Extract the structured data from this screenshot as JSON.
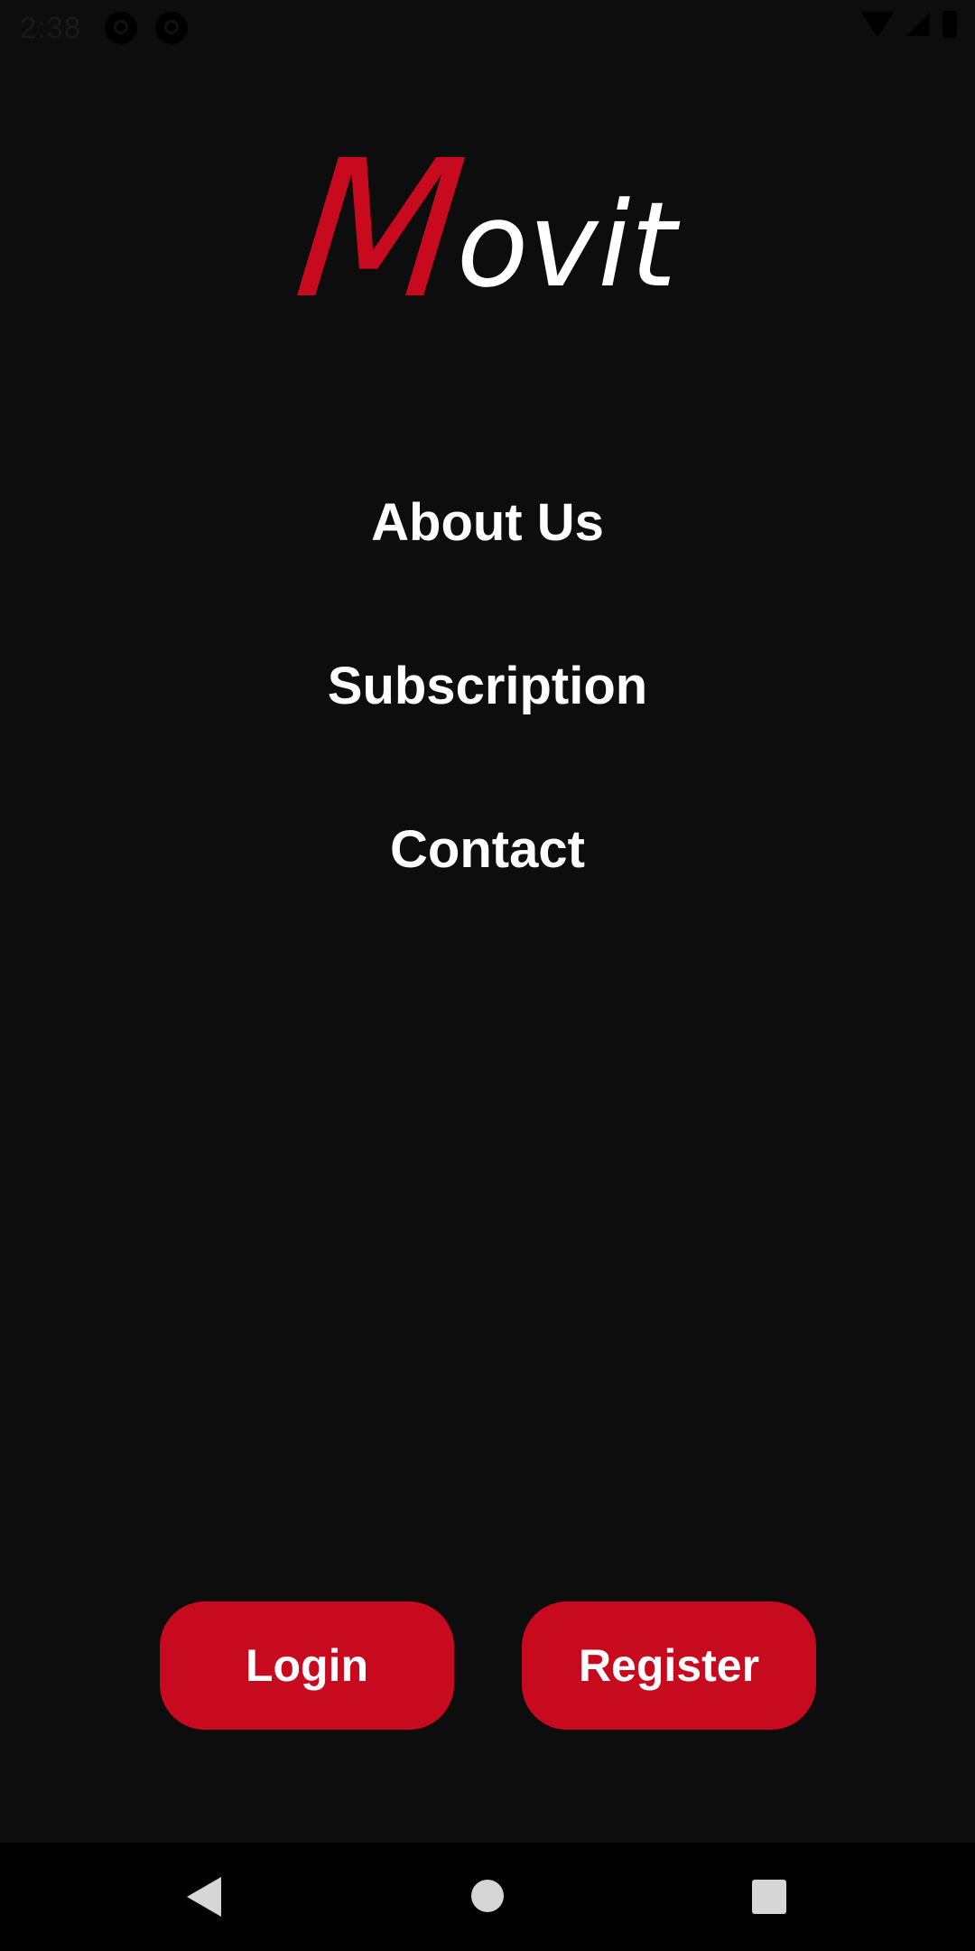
{
  "status_bar": {
    "time": "2:38",
    "icons": [
      "app-notification-icon",
      "data-saver-icon",
      "wifi-icon",
      "signal-icon",
      "battery-icon"
    ]
  },
  "logo": {
    "letter_m": "M",
    "rest": "ovit",
    "m_color": "#c80a1e",
    "rest_color": "#ffffff"
  },
  "menu": {
    "items": [
      {
        "label": "About Us"
      },
      {
        "label": "Subscription"
      },
      {
        "label": "Contact"
      }
    ]
  },
  "buttons": {
    "login": "Login",
    "register": "Register",
    "color": "#c80a1e"
  },
  "navigation_bar": {
    "icons": [
      "back-icon",
      "home-icon",
      "recents-icon"
    ]
  },
  "theme": {
    "background": "#0d0d0d",
    "accent": "#c80a1e"
  }
}
